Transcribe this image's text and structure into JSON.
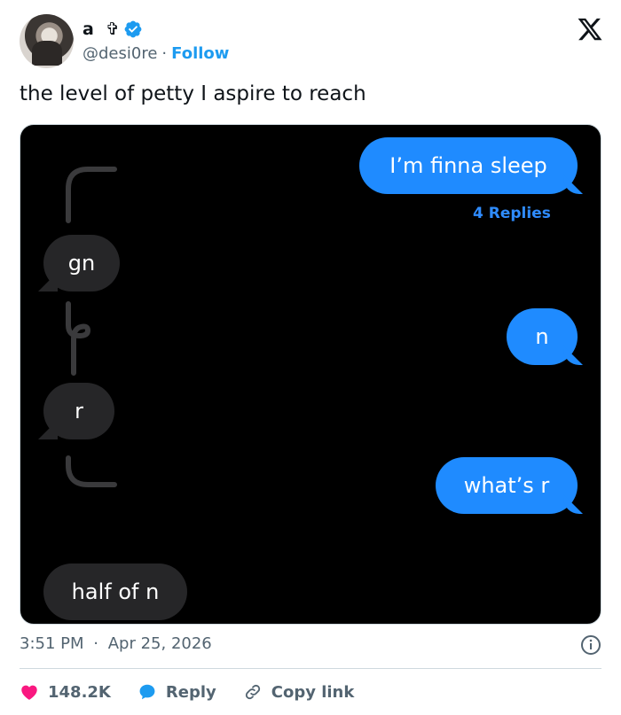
{
  "header": {
    "display_name": "a⁠ ⁠⁠⁠ ✞",
    "handle": "@desi0re",
    "separator": "·",
    "follow_label": "Follow"
  },
  "tweet": {
    "text": "the level of petty I aspire to reach"
  },
  "media": {
    "messages": [
      {
        "side": "right",
        "text": "I’m finna sleep"
      },
      {
        "side": "left",
        "text": "gn"
      },
      {
        "side": "right",
        "text": "n"
      },
      {
        "side": "left",
        "text": "r"
      },
      {
        "side": "right",
        "text": "what’s r"
      },
      {
        "side": "left",
        "text": "half of n"
      }
    ],
    "replies_label": "4 Replies"
  },
  "meta": {
    "time": "3:51 PM",
    "separator": "·",
    "date": "Apr 25, 2026"
  },
  "actions": {
    "likes": "148.2K",
    "reply_label": "Reply",
    "copy_label": "Copy link"
  },
  "colors": {
    "accent": "#1d9bf0",
    "imessage_blue": "#1f8bff",
    "bubble_gray": "#262628",
    "like_red": "#f91880"
  }
}
